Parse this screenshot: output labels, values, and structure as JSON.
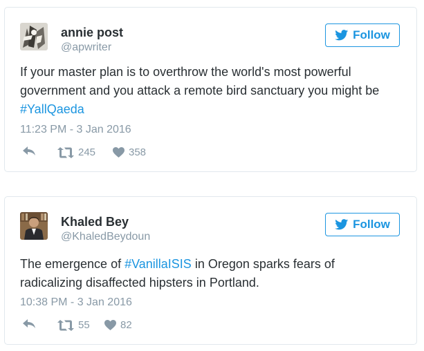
{
  "tweets": [
    {
      "name": "annie post",
      "handle": "@apwriter",
      "follow_label": "Follow",
      "text_lines": [
        [
          "If your master plan is to overthrow the world's most powerful"
        ],
        [
          "government and you attack a remote bird sanctuary you might be"
        ]
      ],
      "hashtag_line": "#YallQaeda",
      "timestamp": "11:23 PM - 3 Jan 2016",
      "retweets": "245",
      "likes": "358"
    },
    {
      "name": "Khaled Bey",
      "handle": "@KhaledBeydoun",
      "follow_label": "Follow",
      "text_before": "The emergence of ",
      "hashtag": "#VanillaISIS",
      "text_after": " in Oregon sparks fears of",
      "text_line2": "radicalizing disaffected hipsters in Portland.",
      "timestamp": "10:38 PM - 3 Jan 2016",
      "retweets": "55",
      "likes": "82"
    }
  ],
  "colors": {
    "twitter_blue": "#1b95e0",
    "muted_gray": "#8899a6",
    "text": "#292f33",
    "border": "#e1e8ed"
  },
  "icons": [
    "twitter-bird-icon",
    "reply-icon",
    "retweet-icon",
    "heart-icon"
  ]
}
